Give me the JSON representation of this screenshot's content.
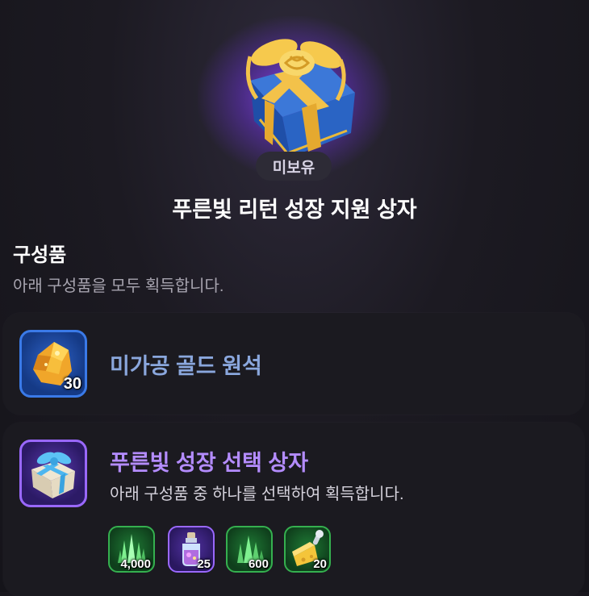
{
  "item": {
    "status_badge": "미보유",
    "title": "푸른빛 리턴 성장 지원 상자"
  },
  "contents_section": {
    "title": "구성품",
    "description": "아래 구성품을 모두 획득합니다."
  },
  "components": [
    {
      "name": "미가공 골드 원석",
      "quantity": "30",
      "icon": "gold-ore-icon",
      "frame_color": "#3a7ae8",
      "name_color": "#8aa7dd"
    },
    {
      "name": "푸른빛 성장 선택 상자",
      "description": "아래 구성품 중 하나를 선택하여 획득합니다.",
      "icon": "gift-box-icon",
      "frame_color": "#9a68ff",
      "name_color": "#b48cff",
      "choices": [
        {
          "quantity": "4,000",
          "icon": "green-crystal-icon",
          "frame_color": "#35b04f"
        },
        {
          "quantity": "25",
          "icon": "potion-bottle-icon",
          "frame_color": "#9a68ff"
        },
        {
          "quantity": "600",
          "icon": "green-crystal-icon",
          "frame_color": "#35b04f"
        },
        {
          "quantity": "20",
          "icon": "cheese-icon",
          "frame_color": "#35b04f"
        }
      ]
    }
  ]
}
